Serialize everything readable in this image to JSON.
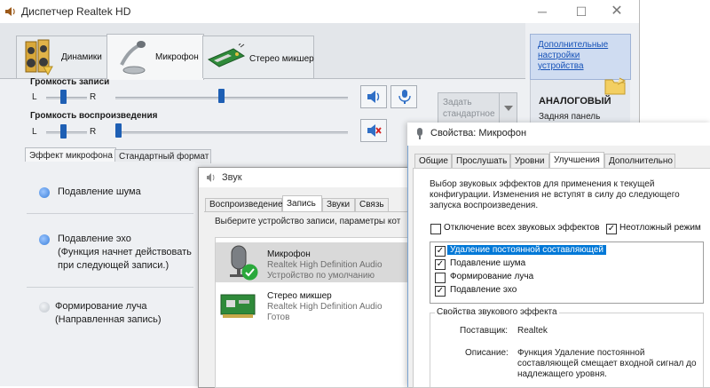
{
  "realtek": {
    "title": "Диспетчер Realtek HD",
    "tabs": [
      {
        "label": "Динамики"
      },
      {
        "label": "Микрофон"
      },
      {
        "label": "Стерео микшер"
      }
    ],
    "record_volume": {
      "label": "Громкость записи",
      "left": "L",
      "right": "R",
      "balance": 0.5,
      "level": 0.46
    },
    "playback_volume": {
      "label": "Громкость воспроизведения",
      "left": "L",
      "right": "R",
      "balance": 0.5,
      "level": 0.02
    },
    "default_device_button": "Задать стандартное",
    "side_panel": {
      "link": "Дополнительные настройки устройства",
      "analog": "АНАЛОГОВЫЙ",
      "rear_panel": "Задняя панель"
    },
    "subtabs": [
      {
        "label": "Эффект микрофона"
      },
      {
        "label": "Стандартный формат"
      }
    ],
    "effects": [
      {
        "line1": "Подавление шума",
        "line2": "",
        "line3": "",
        "state": "blue"
      },
      {
        "line1": "Подавление эхо",
        "line2": "(Функция начнет действовать",
        "line3": "при следующей записи.)",
        "state": "blue"
      },
      {
        "line1": "Формирование луча",
        "line2": "(Направленная запись)",
        "line3": "",
        "state": "grey"
      }
    ]
  },
  "sound": {
    "title": "Звук",
    "tabs": [
      "Воспроизведение",
      "Запись",
      "Звуки",
      "Связь"
    ],
    "instruction": "Выберите устройство записи, параметры кот",
    "devices": [
      {
        "name": "Микрофон",
        "driver": "Realtek High Definition Audio",
        "status": "Устройство по умолчанию"
      },
      {
        "name": "Стерео микшер",
        "driver": "Realtek High Definition Audio",
        "status": "Готов"
      }
    ]
  },
  "mic_props": {
    "title": "Свойства: Микрофон",
    "tabs": [
      "Общие",
      "Прослушать",
      "Уровни",
      "Улучшения",
      "Дополнительно"
    ],
    "intro": [
      "Выбор звуковых эффектов для применения к текущей",
      "конфигурации. Изменения не вступят в силу до следующего",
      "запуска воспроизведения."
    ],
    "disable_all": {
      "label": "Отключение всех звуковых эффектов",
      "checked": false
    },
    "immediate": {
      "label": "Неотложный режим",
      "checked": true
    },
    "effects": [
      {
        "label": "Удаление постоянной составляющей",
        "checked": true,
        "selected": true
      },
      {
        "label": "Подавление шума",
        "checked": true,
        "selected": false
      },
      {
        "label": "Формирование луча",
        "checked": false,
        "selected": false
      },
      {
        "label": "Подавление эхо",
        "checked": true,
        "selected": false
      }
    ],
    "group_title": "Свойства звукового эффекта",
    "provider_label": "Поставщик:",
    "provider_value": "Realtek",
    "desc_label": "Описание:",
    "desc_lines": [
      "Функция Удаление постоянной",
      "составляющей смещает входной сигнал до",
      "надлежащего уровня."
    ]
  },
  "colors": {
    "accent": "#1e5fb4",
    "selection": "#0078d7",
    "radio_blue": "#4a8fe0",
    "radio_grey": "#c8cdd3"
  }
}
